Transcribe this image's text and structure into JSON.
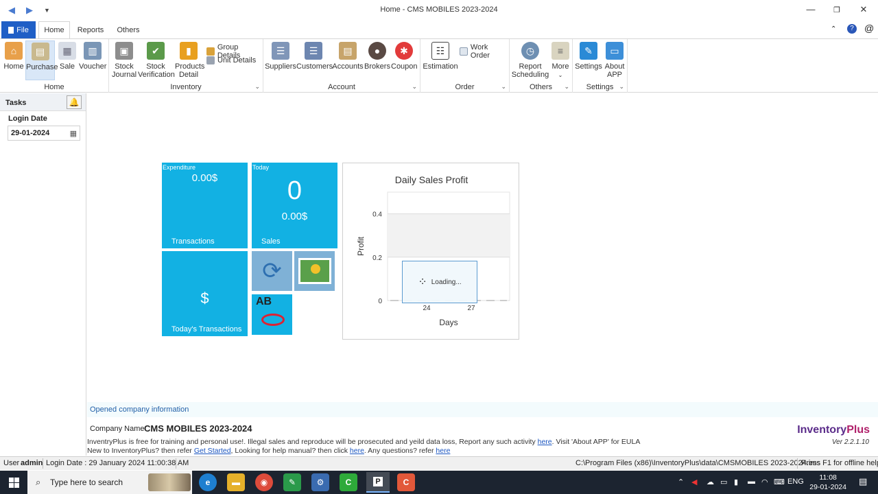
{
  "window": {
    "title": "Home - CMS MOBILES 2023-2024"
  },
  "tabs": {
    "file": "File",
    "home": "Home",
    "reports": "Reports",
    "others": "Others"
  },
  "ribbon": {
    "home_group": {
      "label": "Home",
      "home": "Home",
      "purchase": "Purchase",
      "sale": "Sale",
      "voucher": "Voucher"
    },
    "inventory_group": {
      "label": "Inventory",
      "stock_journal_1": "Stock",
      "stock_journal_2": "Journal",
      "stock_verif_1": "Stock",
      "stock_verif_2": "Verification",
      "products_1": "Products",
      "products_2": "Detail",
      "group_details": "Group Details",
      "unit_details": "Unit Details"
    },
    "account_group": {
      "label": "Account",
      "suppliers": "Suppliers",
      "customers": "Customers",
      "accounts": "Accounts",
      "brokers": "Brokers",
      "coupon": "Coupon"
    },
    "order_group": {
      "label": "Order",
      "estimation": "Estimation",
      "work_order": "Work Order"
    },
    "others_group": {
      "label": "Others",
      "report_1": "Report",
      "report_2": "Scheduling",
      "more": "More"
    },
    "settings_group": {
      "label": "Settings",
      "settings": "Settings",
      "about_1": "About",
      "about_2": "APP"
    }
  },
  "tasks": {
    "title": "Tasks",
    "login_label": "Login Date",
    "login_value": "29-01-2024"
  },
  "tiles": {
    "expenditure": {
      "caption": "Expenditure",
      "value": "0.00$",
      "footer": "Transactions"
    },
    "today": {
      "caption": "Today",
      "count": "0",
      "value": "0.00$",
      "footer": "Sales"
    },
    "transactions": {
      "symbol": "$",
      "footer": "Today's Transactions"
    }
  },
  "chart_data": {
    "type": "line",
    "title": "Daily Sales Profit",
    "xlabel": "Days",
    "ylabel": "Profit",
    "x_ticks": [
      "24",
      "27"
    ],
    "y_ticks": [
      "0",
      "0.2",
      "0.4"
    ],
    "ylim": [
      0,
      0.5
    ],
    "grid": true,
    "loading_text": "Loading..."
  },
  "info": {
    "opened": "Opened company information",
    "company_label": "Company Name",
    "company_name": "CMS MOBILES 2023-2024",
    "line1_a": "InventryPlus is free for training and personal use!. Illegal sales and reproduce will be prosecuted and yeild data loss, Report any such activity ",
    "line1_link": "here",
    "line1_b": ". Visit 'About APP' for EULA",
    "line2_a": "New to InventoryPlus? then refer ",
    "line2_link1": "Get Started",
    "line2_b": ", Looking for help manual? then click ",
    "line2_link2": "here",
    "line2_c": ". Any questions? refer ",
    "line2_link3": "here",
    "brand_pre": "Inventory",
    "brand_post": "Plus",
    "version": "Ver 2.2.1.10"
  },
  "status": {
    "user_label": "User",
    "user_value": "admin",
    "login": "Login Date : 29 January 2024 11:00:38 AM",
    "path": "C:\\Program Files (x86)\\InventoryPlus\\data\\CMSMOBILES 2023-2024.ims",
    "help": "Press F1 for offline help"
  },
  "taskbar": {
    "search_placeholder": "Type here to search",
    "lang": "ENG",
    "time": "11:08",
    "date": "29-01-2024"
  },
  "colors": {
    "tile": "#12b1e3",
    "file_tab": "#1f5fc6",
    "brand": "#b0206a"
  }
}
